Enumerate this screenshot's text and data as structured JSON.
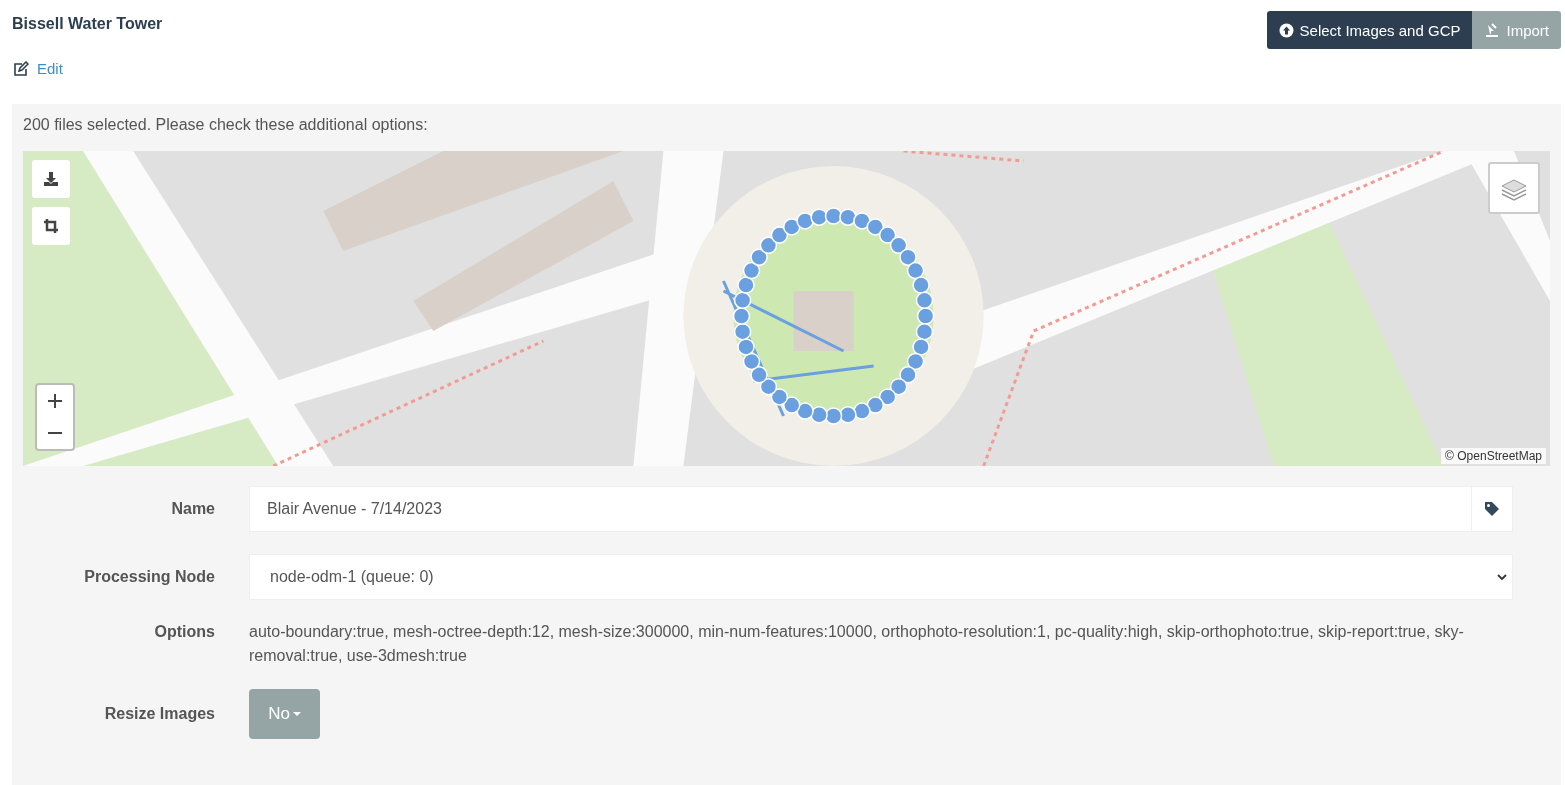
{
  "project": {
    "title": "Bissell Water Tower",
    "edit_link": "Edit"
  },
  "toolbar": {
    "buttons": [
      {
        "label": "Select Images and GCP",
        "kind": "primary"
      },
      {
        "label": "Import",
        "kind": "secondary"
      }
    ]
  },
  "panel": {
    "message": "200 files selected. Please check these additional options:",
    "map": {
      "kind": "picture",
      "attribution": "© OpenStreetMap"
    },
    "fields": [
      {
        "kind": "text",
        "label": "Name",
        "value": "Blair Avenue - 7/14/2023"
      },
      {
        "kind": "select",
        "label": "Processing Node",
        "value": "node-odm-1 (queue: 0)"
      },
      {
        "kind": "static",
        "label": "Options",
        "value": "auto-boundary:true, mesh-octree-depth:12, mesh-size:300000, min-num-features:10000, orthophoto-resolution:1, pc-quality:high, skip-orthophoto:true, skip-report:true, sky-removal:true, use-3dmesh:true"
      },
      {
        "kind": "dropdown",
        "label": "Resize Images",
        "value": "No"
      }
    ]
  }
}
